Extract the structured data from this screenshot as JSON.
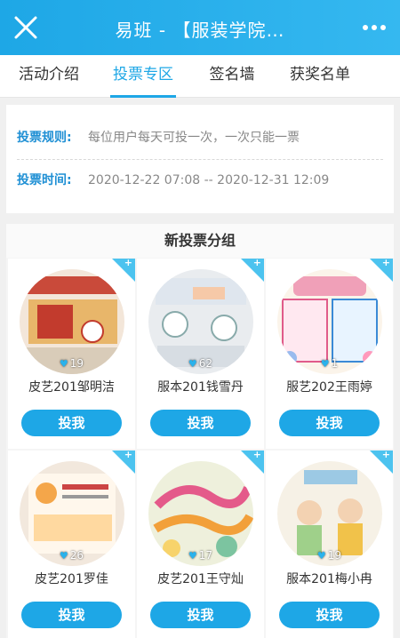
{
  "header": {
    "title": "易班 - 【服装学院…",
    "close_icon": "close-icon",
    "more_icon": "more-icon"
  },
  "tabs": [
    {
      "label": "活动介绍"
    },
    {
      "label": "投票专区",
      "active": true
    },
    {
      "label": "签名墙"
    },
    {
      "label": "获奖名单"
    }
  ],
  "rules": {
    "rule_label": "投票规则:",
    "rule_value": "每位用户每天可投一次，一次只能一票",
    "time_label": "投票时间:",
    "time_value": "2020-12-22 07:08 -- 2020-12-31 12:09"
  },
  "group": {
    "title": "新投票分组",
    "vote_label": "投我",
    "cards": [
      {
        "name": "皮艺201邹明洁",
        "votes": "19"
      },
      {
        "name": "服本201钱雪丹",
        "votes": "62"
      },
      {
        "name": "服艺202王雨婷",
        "votes": "1"
      },
      {
        "name": "皮艺201罗佳",
        "votes": "26"
      },
      {
        "name": "皮艺201王守灿",
        "votes": "17"
      },
      {
        "name": "服本201梅小冉",
        "votes": "19"
      }
    ]
  },
  "colors": {
    "brand": "#1ea7e6",
    "label_blue": "#1e8fd4",
    "corner": "#4cc3ef"
  }
}
